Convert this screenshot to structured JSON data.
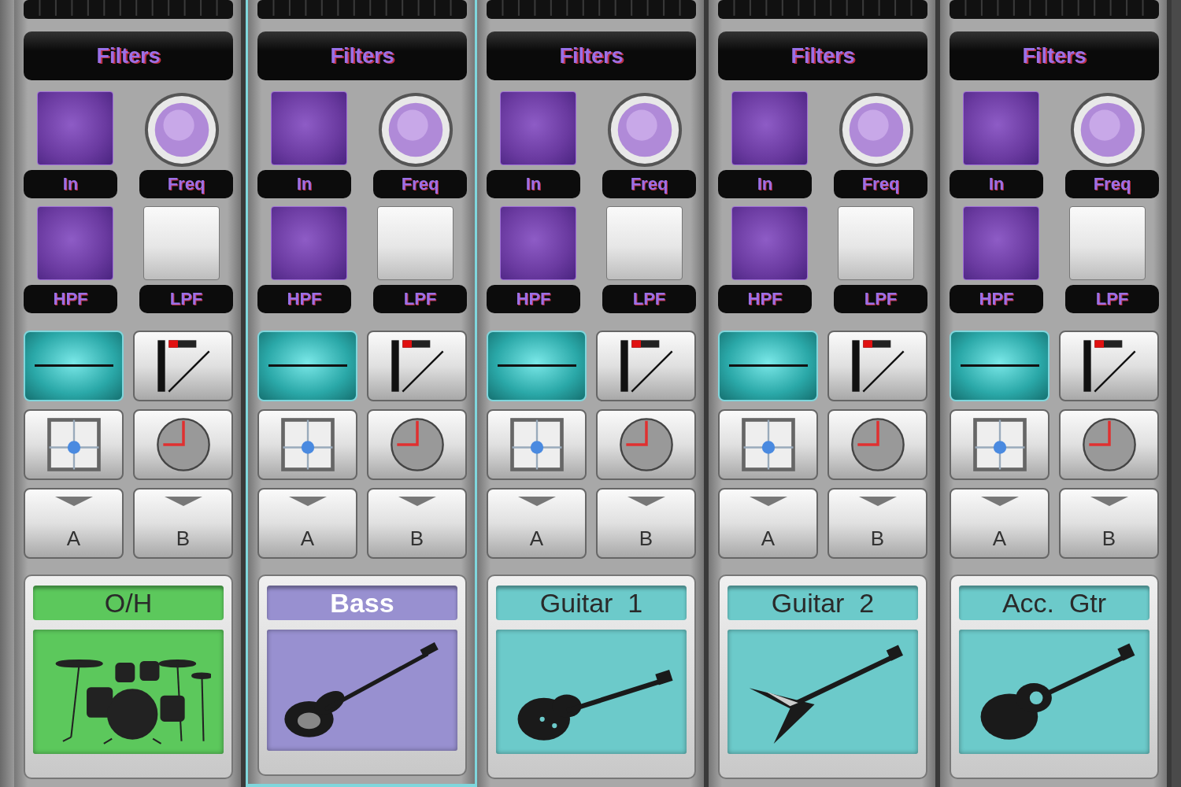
{
  "channels": [
    {
      "name": "O/H",
      "color": "#5cc85c",
      "selected": false,
      "picture": {
        "kind": "drums"
      },
      "filters": "Filters",
      "flat_on": true,
      "controls": [
        {
          "label": "In",
          "kind": "pad",
          "on": true
        },
        {
          "label": "Freq",
          "kind": "knob"
        },
        {
          "label": "HPF",
          "kind": "pad",
          "on": true
        },
        {
          "label": "LPF",
          "kind": "pad",
          "on": false
        }
      ],
      "sends": [
        "A",
        "B"
      ]
    },
    {
      "name": "Bass",
      "color": "#9890d0",
      "selected": true,
      "picture": {
        "kind": "bass"
      },
      "filters": "Filters",
      "flat_on": true,
      "controls": [
        {
          "label": "In",
          "kind": "pad",
          "on": true
        },
        {
          "label": "Freq",
          "kind": "knob"
        },
        {
          "label": "HPF",
          "kind": "pad",
          "on": true
        },
        {
          "label": "LPF",
          "kind": "pad",
          "on": false
        }
      ],
      "sends": [
        "A",
        "B"
      ]
    },
    {
      "name": "Guitar  1",
      "color": "#6ccaca",
      "selected": false,
      "picture": {
        "kind": "electric"
      },
      "filters": "Filters",
      "flat_on": true,
      "controls": [
        {
          "label": "In",
          "kind": "pad",
          "on": true
        },
        {
          "label": "Freq",
          "kind": "knob"
        },
        {
          "label": "HPF",
          "kind": "pad",
          "on": true
        },
        {
          "label": "LPF",
          "kind": "pad",
          "on": false
        }
      ],
      "sends": [
        "A",
        "B"
      ]
    },
    {
      "name": "Guitar  2",
      "color": "#6ccaca",
      "selected": false,
      "picture": {
        "kind": "vshape"
      },
      "filters": "Filters",
      "flat_on": true,
      "controls": [
        {
          "label": "In",
          "kind": "pad",
          "on": true
        },
        {
          "label": "Freq",
          "kind": "knob"
        },
        {
          "label": "HPF",
          "kind": "pad",
          "on": true
        },
        {
          "label": "LPF",
          "kind": "pad",
          "on": false
        }
      ],
      "sends": [
        "A",
        "B"
      ]
    },
    {
      "name": "Acc.  Gtr",
      "color": "#6ccaca",
      "selected": false,
      "picture": {
        "kind": "acoustic"
      },
      "filters": "Filters",
      "flat_on": true,
      "controls": [
        {
          "label": "In",
          "kind": "pad",
          "on": true
        },
        {
          "label": "Freq",
          "kind": "knob"
        },
        {
          "label": "HPF",
          "kind": "pad",
          "on": true
        },
        {
          "label": "LPF",
          "kind": "pad",
          "on": false
        }
      ],
      "sends": [
        "A",
        "B"
      ]
    }
  ]
}
